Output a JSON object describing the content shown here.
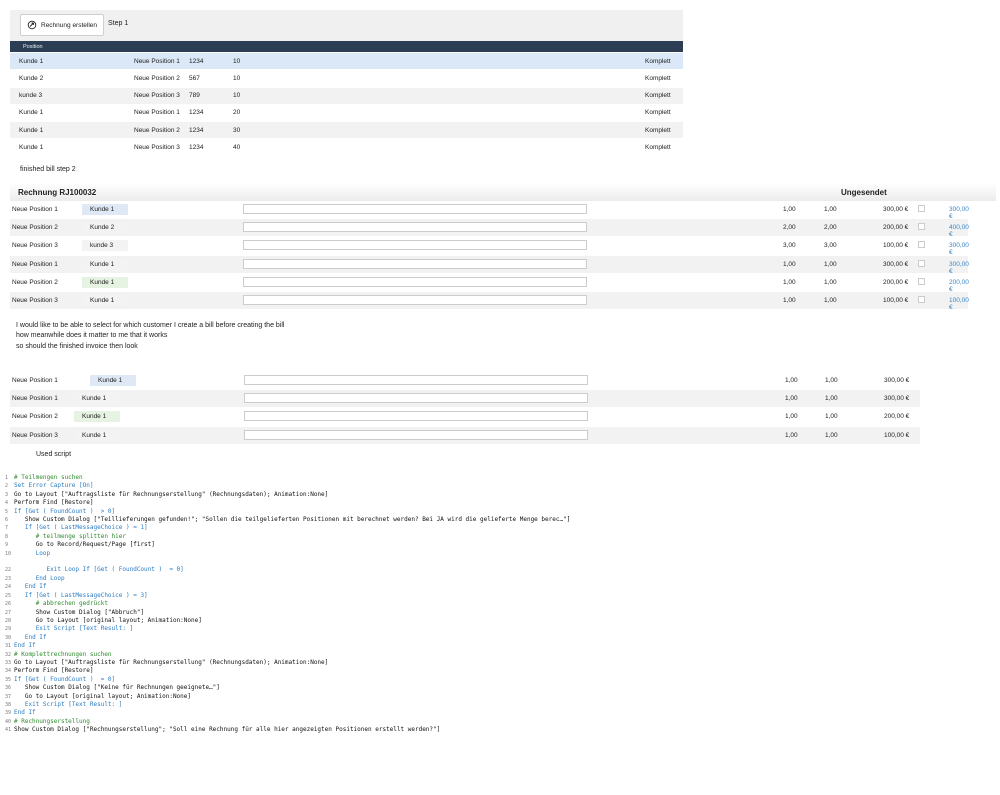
{
  "toolbar": {
    "button_label": "Rechnung erstellen",
    "step_label": "Step 1"
  },
  "table1": {
    "header": "Position",
    "rows": [
      {
        "customer": "Kunde 1",
        "position": "Neue Position 1",
        "number": "1234",
        "qty": "10",
        "status": "Komplett"
      },
      {
        "customer": "Kunde 2",
        "position": "Neue Position 2",
        "number": "567",
        "qty": "10",
        "status": "Komplett"
      },
      {
        "customer": "kunde 3",
        "position": "Neue Position 3",
        "number": "789",
        "qty": "10",
        "status": "Komplett"
      },
      {
        "customer": "Kunde 1",
        "position": "Neue Position 1",
        "number": "1234",
        "qty": "20",
        "status": "Komplett"
      },
      {
        "customer": "Kunde 1",
        "position": "Neue Position 2",
        "number": "1234",
        "qty": "30",
        "status": "Komplett"
      },
      {
        "customer": "Kunde 1",
        "position": "Neue Position 3",
        "number": "1234",
        "qty": "40",
        "status": "Komplett"
      }
    ]
  },
  "step2_label": "finished bill step 2",
  "invoice": {
    "title": "Rechnung RJ100032",
    "status": "Ungesendet",
    "rows": [
      {
        "position": "Neue Position 1",
        "customer": "Kunde 1",
        "a": "1,00",
        "b": "1,00",
        "price": "300,00 €",
        "total": "300,00 €"
      },
      {
        "position": "Neue Position 2",
        "customer": "Kunde 2",
        "a": "2,00",
        "b": "2,00",
        "price": "200,00 €",
        "total": "400,00 €"
      },
      {
        "position": "Neue Position 3",
        "customer": "kunde 3",
        "a": "3,00",
        "b": "3,00",
        "price": "100,00 €",
        "total": "300,00 €"
      },
      {
        "position": "Neue Position 1",
        "customer": "Kunde 1",
        "a": "1,00",
        "b": "1,00",
        "price": "300,00 €",
        "total": "300,00 €"
      },
      {
        "position": "Neue Position 2",
        "customer": "Kunde 1",
        "a": "1,00",
        "b": "1,00",
        "price": "200,00 €",
        "total": "200,00 €"
      },
      {
        "position": "Neue Position 3",
        "customer": "Kunde 1",
        "a": "1,00",
        "b": "1,00",
        "price": "100,00 €",
        "total": "100,00 €"
      }
    ]
  },
  "notes": [
    "I would like to be able to select for which customer I create a bill before creating the bill",
    "how meanwhile does it matter to me that it works",
    "so should the finished invoice then look"
  ],
  "table3": {
    "rows": [
      {
        "position": "Neue Position 1",
        "customer": "Kunde 1",
        "a": "1,00",
        "b": "1,00",
        "price": "300,00 €"
      },
      {
        "position": "Neue Position 1",
        "customer": "Kunde 1",
        "a": "1,00",
        "b": "1,00",
        "price": "300,00 €"
      },
      {
        "position": "Neue Position 2",
        "customer": "Kunde 1",
        "a": "1,00",
        "b": "1,00",
        "price": "200,00 €"
      },
      {
        "position": "Neue Position 3",
        "customer": "Kunde 1",
        "a": "1,00",
        "b": "1,00",
        "price": "100,00 €"
      }
    ]
  },
  "script_label": "Used script",
  "script_lines": [
    {
      "n": "1",
      "indent": 0,
      "t": "# Teilmengen suchen",
      "c": "cm"
    },
    {
      "n": "2",
      "indent": 0,
      "t": "Set Error Capture [On]",
      "c": "kw"
    },
    {
      "n": "3",
      "indent": 0,
      "t": "Go to Layout [\"Auftragsliste für Rechnungserstellung\" (Rechnungsdaten); Animation:None]",
      "c": ""
    },
    {
      "n": "4",
      "indent": 0,
      "t": "Perform Find [Restore]",
      "c": ""
    },
    {
      "n": "5",
      "indent": 0,
      "t": "If [Get ( FoundCount )  > 0]",
      "c": "kw"
    },
    {
      "n": "6",
      "indent": 1,
      "t": "Show Custom Dialog [\"Teillieferungen gefunden!\"; \"Sollen die teilgelieferten Positionen mit berechnet werden? Bei JA wird die gelieferte Menge berec…\"]",
      "c": ""
    },
    {
      "n": "7",
      "indent": 1,
      "t": "If [Get ( LastMessageChoice ) = 1]",
      "c": "kw"
    },
    {
      "n": "8",
      "indent": 2,
      "t": "# teilmenge splitten hier",
      "c": "cm"
    },
    {
      "n": "9",
      "indent": 2,
      "t": "Go to Record/Request/Page [first]",
      "c": ""
    },
    {
      "n": "10",
      "indent": 2,
      "t": "Loop",
      "c": "kw"
    },
    {
      "n": "",
      "indent": 0,
      "t": "",
      "c": ""
    },
    {
      "n": "22",
      "indent": 3,
      "t": "Exit Loop If [Get ( FoundCount )  = 0]",
      "c": "kw"
    },
    {
      "n": "23",
      "indent": 2,
      "t": "End Loop",
      "c": "kw"
    },
    {
      "n": "24",
      "indent": 1,
      "t": "End If",
      "c": "kw"
    },
    {
      "n": "25",
      "indent": 1,
      "t": "If [Get ( LastMessageChoice ) = 3]",
      "c": "kw"
    },
    {
      "n": "26",
      "indent": 2,
      "t": "# abbrechen gedrückt",
      "c": "cm"
    },
    {
      "n": "27",
      "indent": 2,
      "t": "Show Custom Dialog [\"Abbruch\"]",
      "c": ""
    },
    {
      "n": "28",
      "indent": 2,
      "t": "Go to Layout [original layout; Animation:None]",
      "c": ""
    },
    {
      "n": "29",
      "indent": 2,
      "t": "Exit Script [Text Result: ]",
      "c": "kw"
    },
    {
      "n": "30",
      "indent": 1,
      "t": "End If",
      "c": "kw"
    },
    {
      "n": "31",
      "indent": 0,
      "t": "End If",
      "c": "kw"
    },
    {
      "n": "32",
      "indent": 0,
      "t": "# Komplettrechnungen suchen",
      "c": "cm"
    },
    {
      "n": "33",
      "indent": 0,
      "t": "Go to Layout [\"Auftragsliste für Rechnungserstellung\" (Rechnungsdaten); Animation:None]",
      "c": ""
    },
    {
      "n": "34",
      "indent": 0,
      "t": "Perform Find [Restore]",
      "c": ""
    },
    {
      "n": "35",
      "indent": 0,
      "t": "If [Get ( FoundCount )  = 0]",
      "c": "kw"
    },
    {
      "n": "36",
      "indent": 1,
      "t": "Show Custom Dialog [\"Keine für Rechnungen geeignete…\"]",
      "c": ""
    },
    {
      "n": "37",
      "indent": 1,
      "t": "Go to Layout [original layout; Animation:None]",
      "c": ""
    },
    {
      "n": "38",
      "indent": 1,
      "t": "Exit Script [Text Result: ]",
      "c": "kw"
    },
    {
      "n": "39",
      "indent": 0,
      "t": "End If",
      "c": "kw"
    },
    {
      "n": "40",
      "indent": 0,
      "t": "# Rechnungserstellung",
      "c": "cm"
    },
    {
      "n": "41",
      "indent": 0,
      "t": "Show Custom Dialog [\"Rechnungserstellung\"; \"Soll eine Rechnung für alle hier angezeigten Positionen erstellt werden?\"]",
      "c": ""
    }
  ]
}
